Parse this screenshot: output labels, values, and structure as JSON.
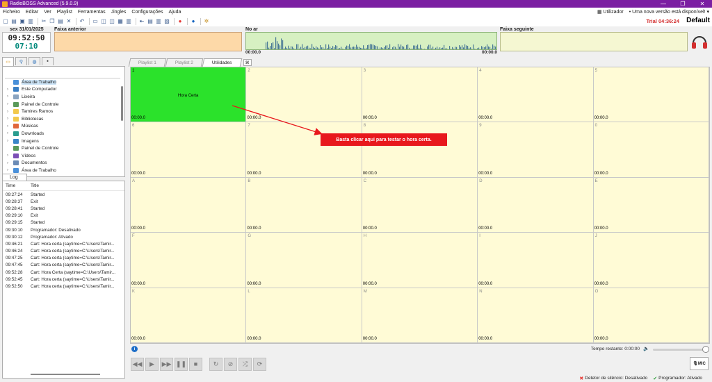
{
  "window": {
    "title": "RadioBOSS Advanced (5.9.0.9)",
    "controls": [
      "—",
      "❐",
      "✕"
    ]
  },
  "menu": {
    "items": [
      "Ficheiro",
      "Editar",
      "Ver",
      "Playlist",
      "Ferramentas",
      "Jingles",
      "Configurações",
      "Ajuda"
    ],
    "user": "Utilizador",
    "update_notice": "• Uma nova versão está disponível! ▾"
  },
  "toolbar": {
    "trial": "Trial 04:36:24",
    "profile": "Default"
  },
  "info": {
    "date": "sex 31/01/2025",
    "clock": "09:52:50",
    "countdown": "07:10",
    "prev_label": "Faixa anterior",
    "onair_label": "No ar",
    "onair_start": "00:00.0",
    "onair_end": "00:00.0",
    "next_label": "Faixa seguinte"
  },
  "browser": {
    "tabs": [
      "folder-icon",
      "search-icon",
      "globe-icon",
      "terminal-icon"
    ],
    "tree": [
      {
        "label": "Área de Trabalho",
        "arrow": "",
        "color": "#4a90d9",
        "selected": true
      },
      {
        "label": "Este Computador",
        "arrow": "›",
        "color": "#3b7fc4"
      },
      {
        "label": "Lixeira",
        "arrow": "›",
        "color": "#8aa4c0"
      },
      {
        "label": "Painel de Controle",
        "arrow": "›",
        "color": "#5a9a5a"
      },
      {
        "label": "Tamires Ramos",
        "arrow": "›",
        "color": "#f2c94c"
      },
      {
        "label": "Bibliotecas",
        "arrow": "›",
        "color": "#f2c94c"
      },
      {
        "label": "Músicas",
        "arrow": "›",
        "color": "#e0663a"
      },
      {
        "label": "Downloads",
        "arrow": "›",
        "color": "#2a9d8f"
      },
      {
        "label": "Imagens",
        "arrow": "›",
        "color": "#3a86c8"
      },
      {
        "label": "Painel de Controle",
        "arrow": "",
        "color": "#5a9a5a"
      },
      {
        "label": "Vídeos",
        "arrow": "›",
        "color": "#7b4fb5"
      },
      {
        "label": "Documentos",
        "arrow": "›",
        "color": "#6b8bb5"
      },
      {
        "label": "Área de Trabalho",
        "arrow": "›",
        "color": "#4a90d9"
      }
    ]
  },
  "log": {
    "tab": "Log",
    "col_time": "Time",
    "col_title": "Title",
    "rows": [
      {
        "time": "09:27:24",
        "title": "Started"
      },
      {
        "time": "09:28:37",
        "title": "Exit"
      },
      {
        "time": "09:28:41",
        "title": "Started"
      },
      {
        "time": "09:29:10",
        "title": "Exit"
      },
      {
        "time": "09:29:15",
        "title": "Started"
      },
      {
        "time": "09:30:10",
        "title": "Programador: Desativado"
      },
      {
        "time": "09:30:12",
        "title": "Programador: Ativado"
      },
      {
        "time": "09:46:21",
        "title": "Cart: Hora certa (saytime=C:\\Users\\Tamir..."
      },
      {
        "time": "09:46:24",
        "title": "Cart: Hora certa (saytime=C:\\Users\\Tamir..."
      },
      {
        "time": "09:47:25",
        "title": "Cart: Hora certa (saytime=C:\\Users\\Tamir..."
      },
      {
        "time": "09:47:45",
        "title": "Cart: Hora certa (saytime=C:\\Users\\Tamir..."
      },
      {
        "time": "09:52:28",
        "title": "Cart: Hora Certa (saytime=C:\\Users\\Tamir..."
      },
      {
        "time": "09:52:45",
        "title": "Cart: Hora certa (saytime=C:\\Users\\Tamir..."
      },
      {
        "time": "09:52:50",
        "title": "Cart: Hora certa (saytime=C:\\Users\\Tamir..."
      }
    ]
  },
  "cart_tabs": [
    "Playlist 1",
    "Playlist 2",
    "Utilidades"
  ],
  "active_cart_tab": 2,
  "carts": [
    {
      "key": "1",
      "name": "Hora Certa",
      "time": "00:00.0",
      "active": true
    },
    {
      "key": "2",
      "name": "",
      "time": "00:00.0"
    },
    {
      "key": "3",
      "name": "",
      "time": "00:00.0"
    },
    {
      "key": "4",
      "name": "",
      "time": "00:00.0"
    },
    {
      "key": "5",
      "name": "",
      "time": "00:00.0"
    },
    {
      "key": "6",
      "name": "",
      "time": "00:00.0"
    },
    {
      "key": "7",
      "name": "",
      "time": "00:00.0"
    },
    {
      "key": "8",
      "name": "",
      "time": "00:00.0"
    },
    {
      "key": "9",
      "name": "",
      "time": "00:00.0"
    },
    {
      "key": "0",
      "name": "",
      "time": "00:00.0"
    },
    {
      "key": "A",
      "name": "",
      "time": "00:00.0"
    },
    {
      "key": "B",
      "name": "",
      "time": "00:00.0"
    },
    {
      "key": "C",
      "name": "",
      "time": "00:00.0"
    },
    {
      "key": "D",
      "name": "",
      "time": "00:00.0"
    },
    {
      "key": "E",
      "name": "",
      "time": "00:00.0"
    },
    {
      "key": "F",
      "name": "",
      "time": "00:00.0"
    },
    {
      "key": "G",
      "name": "",
      "time": "00:00.0"
    },
    {
      "key": "H",
      "name": "",
      "time": "00:00.0"
    },
    {
      "key": "I",
      "name": "",
      "time": "00:00.0"
    },
    {
      "key": "J",
      "name": "",
      "time": "00:00.0"
    },
    {
      "key": "K",
      "name": "",
      "time": "00:00.0"
    },
    {
      "key": "L",
      "name": "",
      "time": "00:00.0"
    },
    {
      "key": "M",
      "name": "",
      "time": "00:00.0"
    },
    {
      "key": "N",
      "name": "",
      "time": "00:00.0"
    },
    {
      "key": "O",
      "name": "",
      "time": "00:00.0"
    }
  ],
  "callout": "Basta clicar aqui para testar o hora certa.",
  "player": {
    "remaining": "Tempo restante: 0:00:00",
    "volume": 1.0,
    "mic_label": "MIC"
  },
  "status": {
    "silence": "Detetor de silêncio: Desativado",
    "scheduler": "Programador: Ativado"
  },
  "colors": {
    "titlebar": "#7b1fa2",
    "active_cart": "#2be22b",
    "cart_bg": "#fffbd6",
    "callout": "#e8181d"
  }
}
